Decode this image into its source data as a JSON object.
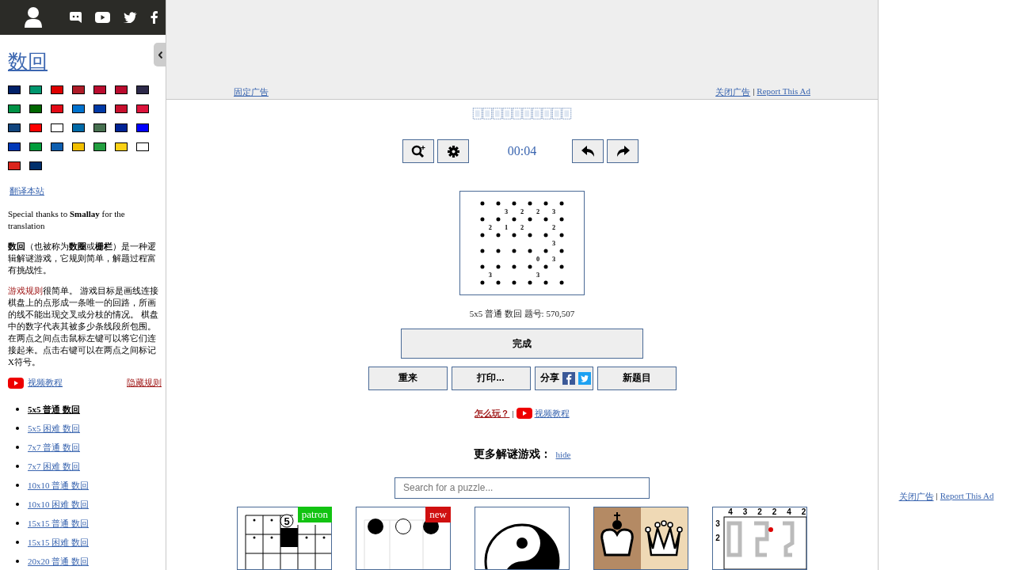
{
  "sidebar": {
    "title": "数回",
    "flags": [
      {
        "color": "#012169"
      },
      {
        "color": "#00966e"
      },
      {
        "color": "#dd0000"
      },
      {
        "color": "#ae1c28"
      },
      {
        "color": "#ba0c2f"
      },
      {
        "color": "#ba0c2f"
      },
      {
        "color": "#2d2a4a"
      },
      {
        "color": "#009246"
      },
      {
        "color": "#006600"
      },
      {
        "color": "#e30a17"
      },
      {
        "color": "#0072ce"
      },
      {
        "color": "#0039a6"
      },
      {
        "color": "#c8102e"
      },
      {
        "color": "#dc143c"
      },
      {
        "color": "#11457e"
      },
      {
        "color": "#fe0000"
      },
      {
        "color": "#ffffff"
      },
      {
        "color": "#006aa7"
      },
      {
        "color": "#477050"
      },
      {
        "color": "#002395"
      },
      {
        "color": "#0000ff"
      },
      {
        "color": "#0038b8"
      },
      {
        "color": "#009c3b"
      },
      {
        "color": "#0d5eaf"
      },
      {
        "color": "#f1bf00"
      },
      {
        "color": "#239f40"
      },
      {
        "color": "#fcd116"
      },
      {
        "color": "#ffffff"
      },
      {
        "color": "#da251d"
      },
      {
        "color": "#002f6c"
      }
    ],
    "translate_link": "翻译本站",
    "thanks": "Special thanks to **Smallay** for the translation",
    "intro": "**数回**（也被称为**数圈**或**栅栏**）是一种逻辑解谜游戏，它规则简单，解题过程富有挑战性。",
    "rules_link": "游戏规则",
    "rules": "很简单。 游戏目标是画线连接棋盘上的点形成一条唯一的回路，所画的线不能出现交叉或分枝的情况。 棋盘中的数字代表其被多少条线段所包围。在两点之间点击鼠标左键可以将它们连接起来。点击右键可以在两点之间标记X符号。",
    "video_link": "视频教程",
    "hide_rules": "隐藏规则",
    "puzzle_links": [
      {
        "label": "5x5 普通 数回",
        "selected": true
      },
      {
        "label": "5x5 困难 数回",
        "selected": false
      },
      {
        "label": "7x7 普通 数回",
        "selected": false
      },
      {
        "label": "7x7 困难 数回",
        "selected": false
      },
      {
        "label": "10x10 普通 数回",
        "selected": false
      },
      {
        "label": "10x10 困难 数回",
        "selected": false
      },
      {
        "label": "15x15 普通 数回",
        "selected": false
      },
      {
        "label": "15x15 困难 数回",
        "selected": false
      },
      {
        "label": "20x20 普通 数回",
        "selected": false
      }
    ]
  },
  "ad_banner": {
    "pin_link": "固定广告",
    "close_link": "关闭广告",
    "separator": "|",
    "report_link": "Report This Ad"
  },
  "game": {
    "timer": "00:04",
    "board": {
      "rows": [
        [
          null,
          "3",
          "2",
          "2",
          "3"
        ],
        [
          "2",
          "1",
          "2",
          null,
          "2"
        ],
        [
          null,
          null,
          null,
          null,
          "3"
        ],
        [
          null,
          null,
          null,
          "0",
          "3"
        ],
        [
          "3",
          null,
          null,
          "3",
          null
        ]
      ]
    },
    "caption": "5x5 普通 数回 题号: 570,507",
    "done_button": "完成",
    "buttons": [
      {
        "kind": "plain",
        "label": "重来"
      },
      {
        "kind": "plain",
        "label": "打印..."
      },
      {
        "kind": "share",
        "label": "分享"
      },
      {
        "kind": "plain",
        "label": "新题目"
      }
    ],
    "how_to": "怎么玩？",
    "separator": "|",
    "video_link": "视频教程"
  },
  "more_puzzles": {
    "heading": "更多解谜游戏：",
    "hide_link": "hide",
    "search": {
      "placeholder": "Search for a puzzle..."
    },
    "tiles": [
      {
        "kind": "number-grid",
        "circled_clue": "5",
        "badge": {
          "kind": "patron",
          "text": "patron"
        }
      },
      {
        "kind": "circles",
        "badge": {
          "kind": "new",
          "text": "new"
        }
      },
      {
        "kind": "yin-yang"
      },
      {
        "kind": "chess"
      },
      {
        "kind": "loop-numbers",
        "top_clues": [
          "4",
          "3",
          "2",
          "2",
          "4",
          "2"
        ],
        "side_clues": [
          "3",
          "2"
        ]
      }
    ]
  },
  "right_ad": {
    "close_link": "关闭广告",
    "separator": "|",
    "report_link": "Report This Ad"
  }
}
